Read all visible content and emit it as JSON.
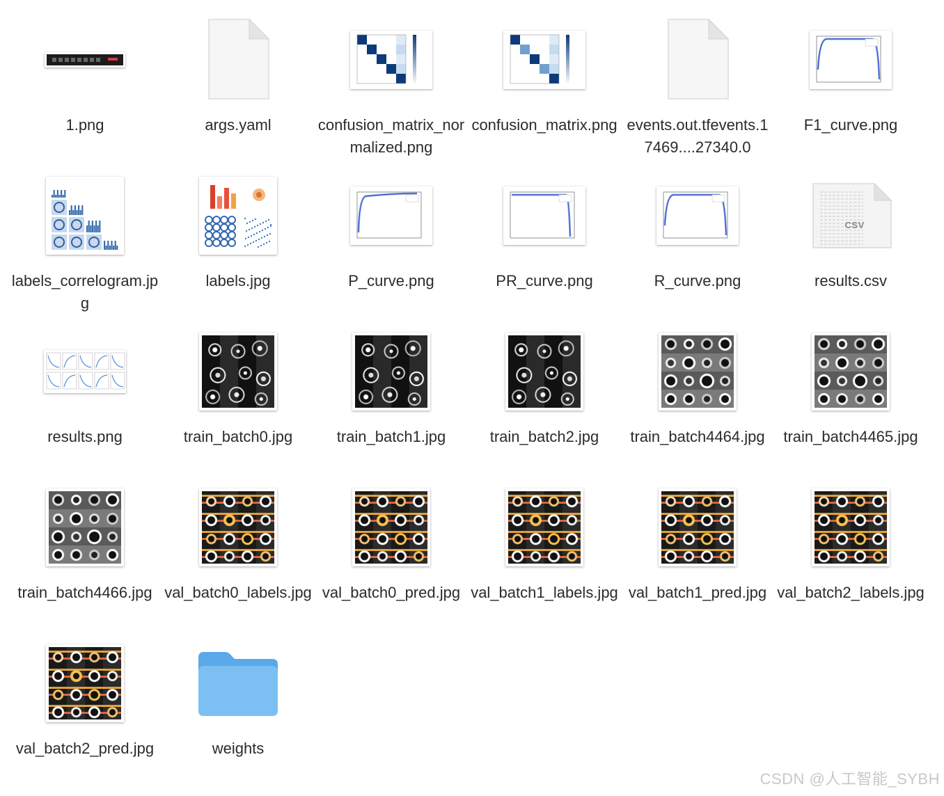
{
  "files": [
    {
      "name": "1.png",
      "thumb": "banner"
    },
    {
      "name": "args.yaml",
      "thumb": "doc"
    },
    {
      "name": "confusion_matrix_normalized.png",
      "thumb": "cm"
    },
    {
      "name": "confusion_matrix.png",
      "thumb": "cm2"
    },
    {
      "name": "events.out.tfevents.17469....27340.0",
      "thumb": "doc"
    },
    {
      "name": "F1_curve.png",
      "thumb": "curve-drop"
    },
    {
      "name": "labels_correlogram.jpg",
      "thumb": "correlogram"
    },
    {
      "name": "labels.jpg",
      "thumb": "labels"
    },
    {
      "name": "P_curve.png",
      "thumb": "curve-rise"
    },
    {
      "name": "PR_curve.png",
      "thumb": "curve-pr"
    },
    {
      "name": "R_curve.png",
      "thumb": "curve-drop"
    },
    {
      "name": "results.csv",
      "thumb": "csv",
      "badge": "CSV"
    },
    {
      "name": "results.png",
      "thumb": "results"
    },
    {
      "name": "train_batch0.jpg",
      "thumb": "mosaic-dark"
    },
    {
      "name": "train_batch1.jpg",
      "thumb": "mosaic-dark"
    },
    {
      "name": "train_batch2.jpg",
      "thumb": "mosaic-dark"
    },
    {
      "name": "train_batch4464.jpg",
      "thumb": "mosaic-gray"
    },
    {
      "name": "train_batch4465.jpg",
      "thumb": "mosaic-gray"
    },
    {
      "name": "train_batch4466.jpg",
      "thumb": "mosaic-gray"
    },
    {
      "name": "val_batch0_labels.jpg",
      "thumb": "mosaic-orange"
    },
    {
      "name": "val_batch0_pred.jpg",
      "thumb": "mosaic-orange"
    },
    {
      "name": "val_batch1_labels.jpg",
      "thumb": "mosaic-orange"
    },
    {
      "name": "val_batch1_pred.jpg",
      "thumb": "mosaic-orange"
    },
    {
      "name": "val_batch2_labels.jpg",
      "thumb": "mosaic-orange"
    },
    {
      "name": "val_batch2_pred.jpg",
      "thumb": "mosaic-orange"
    },
    {
      "name": "weights",
      "thumb": "folder"
    }
  ],
  "colors": {
    "folder": "#7cc0f3",
    "folder_tab": "#5aa9ea",
    "heat": "#0d3a78",
    "curve": "#2b4fc6"
  },
  "watermark": "CSDN @人工智能_SYBH"
}
